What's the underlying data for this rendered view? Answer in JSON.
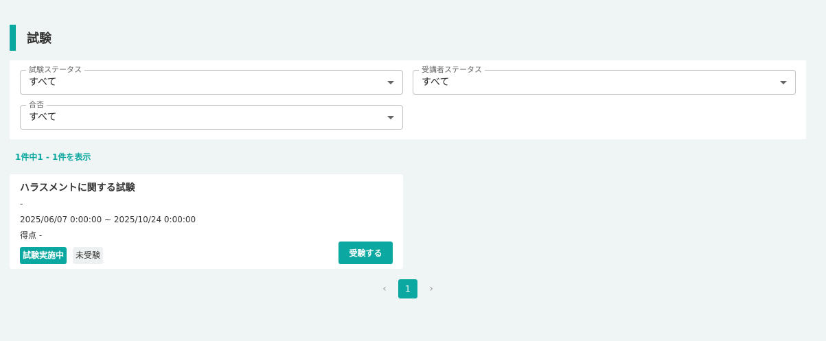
{
  "page": {
    "title": "試験"
  },
  "filters": {
    "exam_status": {
      "label": "試験ステータス",
      "value": "すべて"
    },
    "student_status": {
      "label": "受講者ステータス",
      "value": "すべて"
    },
    "pass_fail": {
      "label": "合否",
      "value": "すべて"
    }
  },
  "results": {
    "count_text": "1件中1 - 1件を表示"
  },
  "exams": [
    {
      "title": "ハラスメントに関する試験",
      "description": "-",
      "period": "2025/06/07 0:00:00 ~ 2025/10/24 0:00:00",
      "score": "得点 -",
      "badge_state": "試験実施中",
      "badge_status": "未受験",
      "action_label": "受験する"
    }
  ],
  "pagination": {
    "prev_icon": "‹",
    "current_page": "1",
    "next_icon": "›"
  },
  "colors": {
    "accent": "#0aa8a0",
    "background": "#eff4f4"
  }
}
